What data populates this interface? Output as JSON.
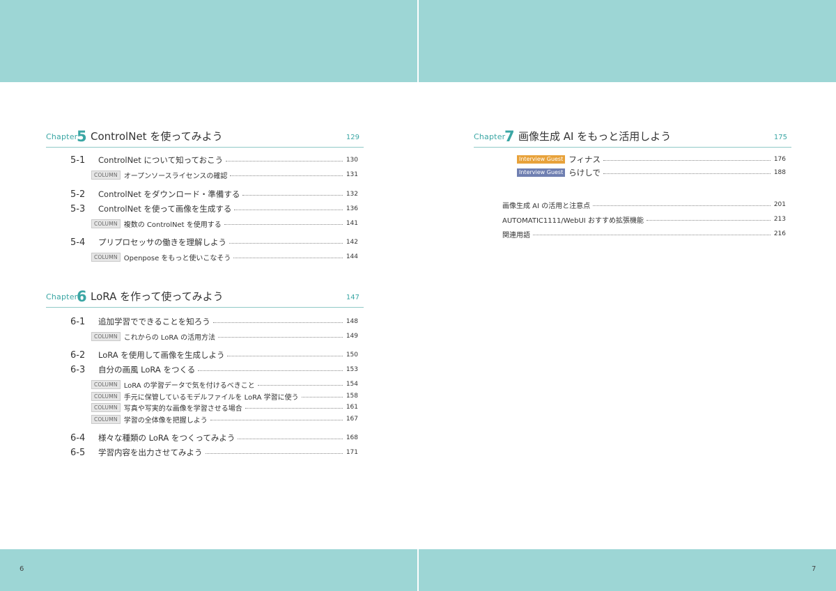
{
  "page_numbers": {
    "left": "6",
    "right": "7"
  },
  "colors": {
    "band": "#9dd6d5",
    "accent": "#3aa6a4",
    "guest_orange": "#e8a23a",
    "guest_blue": "#6f7fb1"
  },
  "chapters": [
    {
      "label": "Chapter",
      "number": "5",
      "title": "ControlNet を使ってみよう",
      "page": "129",
      "entries": [
        {
          "kind": "section",
          "sec": "5-1",
          "text": "ControlNet について知っておこう",
          "page": "130"
        },
        {
          "kind": "column",
          "badge": "COLUMN",
          "text": "オープンソースライセンスの確認",
          "page": "131"
        },
        {
          "kind": "section",
          "sec": "5-2",
          "text": "ControlNet をダウンロード・準備する",
          "page": "132"
        },
        {
          "kind": "section",
          "sec": "5-3",
          "text": "ControlNet を使って画像を生成する",
          "page": "136"
        },
        {
          "kind": "column",
          "badge": "COLUMN",
          "text": "複数の ControlNet を使用する",
          "page": "141"
        },
        {
          "kind": "section",
          "sec": "5-4",
          "text": "プリプロセッサの働きを理解しよう",
          "page": "142"
        },
        {
          "kind": "column",
          "badge": "COLUMN",
          "text": "Openpose をもっと使いこなそう",
          "page": "144"
        }
      ]
    },
    {
      "label": "Chapter",
      "number": "6",
      "title": "LoRA を作って使ってみよう",
      "page": "147",
      "entries": [
        {
          "kind": "section",
          "sec": "6-1",
          "text": "追加学習でできることを知ろう",
          "page": "148"
        },
        {
          "kind": "column",
          "badge": "COLUMN",
          "text": "これからの LoRA の活用方法",
          "page": "149"
        },
        {
          "kind": "section",
          "sec": "6-2",
          "text": "LoRA を使用して画像を生成しよう",
          "page": "150"
        },
        {
          "kind": "section",
          "sec": "6-3",
          "text": "自分の画風 LoRA をつくる",
          "page": "153"
        },
        {
          "kind": "column",
          "badge": "COLUMN",
          "text": "LoRA の学習データで気を付けるべきこと",
          "page": "154"
        },
        {
          "kind": "column",
          "badge": "COLUMN",
          "text": "手元に保管しているモデルファイルを LoRA 学習に使う",
          "page": "158"
        },
        {
          "kind": "column",
          "badge": "COLUMN",
          "text": "写真や写実的な画像を学習させる場合",
          "page": "161"
        },
        {
          "kind": "column",
          "badge": "COLUMN",
          "text": "学習の全体像を把握しよう",
          "page": "167"
        },
        {
          "kind": "section",
          "sec": "6-4",
          "text": "様々な種類の LoRA をつくってみよう",
          "page": "168"
        },
        {
          "kind": "section",
          "sec": "6-5",
          "text": "学習内容を出力させてみよう",
          "page": "171"
        }
      ]
    },
    {
      "label": "Chapter",
      "number": "7",
      "title": "画像生成 AI をもっと活用しよう",
      "page": "175",
      "entries": [
        {
          "kind": "guest",
          "badge": "Interview Guest",
          "text": "フィナス",
          "page": "176"
        },
        {
          "kind": "guest",
          "badge": "Interview Guest",
          "text": "らけしで",
          "page": "188"
        }
      ]
    }
  ],
  "appendix": [
    {
      "text": "画像生成 AI の活用と注意点",
      "page": "201"
    },
    {
      "text": "AUTOMATIC1111/WebUI おすすめ拡張機能",
      "page": "213"
    },
    {
      "text": "関連用語",
      "page": "216"
    }
  ]
}
